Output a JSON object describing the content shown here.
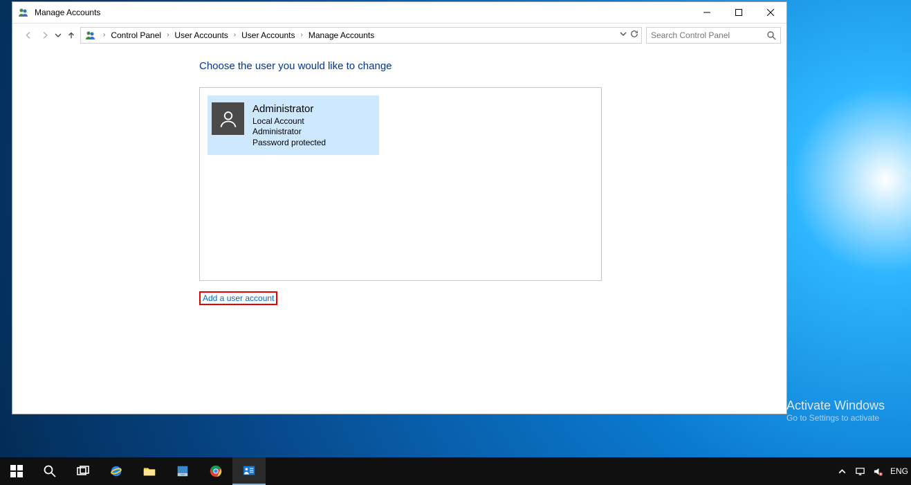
{
  "window": {
    "title": "Manage Accounts"
  },
  "breadcrumbs": {
    "items": [
      "Control Panel",
      "User Accounts",
      "User Accounts",
      "Manage Accounts"
    ]
  },
  "search": {
    "placeholder": "Search Control Panel"
  },
  "content": {
    "heading": "Choose the user you would like to change",
    "user": {
      "name": "Administrator",
      "type": "Local Account",
      "role": "Administrator",
      "pw": "Password protected"
    },
    "add_link": "Add a user account"
  },
  "activate": {
    "title": "Activate Windows",
    "sub": "Go to Settings to activate"
  },
  "tray": {
    "lang": "ENG"
  }
}
